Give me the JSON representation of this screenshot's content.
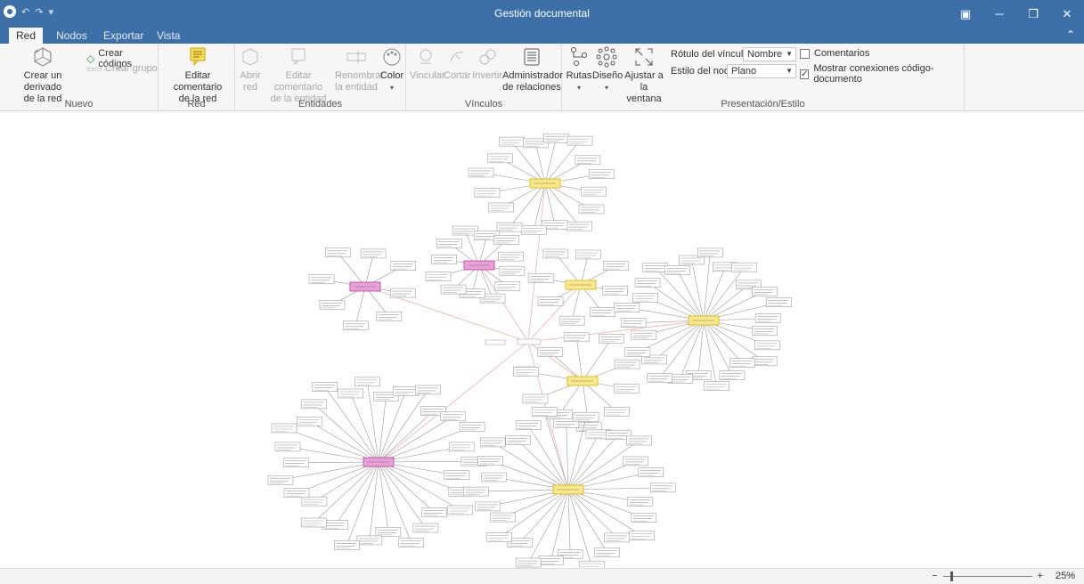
{
  "window": {
    "title": "Gestión documental",
    "qat": {
      "undo": "↶",
      "redo": "↷",
      "customize": "▾"
    },
    "controls": {
      "ribbon_display": "▣",
      "minimize": "─",
      "restore": "❐",
      "close": "✕"
    }
  },
  "tabs": [
    "Red",
    "Nodos",
    "Exportar",
    "Vista"
  ],
  "active_tab": "Red",
  "ribbon": {
    "nuevo": {
      "label": "Nuevo",
      "derivado_line1": "Crear un derivado",
      "derivado_line2": "de la red",
      "crear_codigos": "Crear códigos",
      "crear_grupo": "Crear grupo"
    },
    "red": {
      "label": "Red",
      "editar_line1": "Editar comentario",
      "editar_line2": "de la red"
    },
    "entidades": {
      "label": "Entidades",
      "abrir_line1": "Abrir",
      "abrir_line2": "red",
      "editar_ent_line1": "Editar comentario",
      "editar_ent_line2": "de la entidad",
      "renombrar_line1": "Renombrar",
      "renombrar_line2": "la entidad",
      "color": "Color"
    },
    "vinculos": {
      "label": "Vínculos",
      "vincular": "Vincular",
      "cortar": "Cortar",
      "invertir": "Invertir",
      "admin_line1": "Administrador",
      "admin_line2": "de relaciones"
    },
    "presentacion": {
      "label": "Presentación/Estilo",
      "rutas": "Rutas",
      "diseno": "Diseño",
      "ajustar_line1": "Ajustar a",
      "ajustar_line2": "la ventana",
      "rotulo_label": "Rótulo del vínculo",
      "rotulo_value": "Nombre",
      "estilo_label": "Estilo del nodo",
      "estilo_value": "Plano",
      "comentarios": "Comentarios",
      "comentarios_checked": false,
      "mostrar": "Mostrar conexiones código-documento",
      "mostrar_checked": true
    }
  },
  "network": {
    "hub_color": "#fbe88a",
    "hub_border": "#d4b300",
    "pink_color": "#e8a0d8",
    "pink_border": "#c0389a",
    "edge_color": "#9a9a9a",
    "link_color": "#f0b0a8"
  },
  "status": {
    "zoom_minus": "−",
    "zoom_plus": "+",
    "zoom_level": "25%",
    "zoom_fraction": 0.08
  }
}
